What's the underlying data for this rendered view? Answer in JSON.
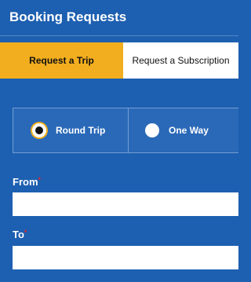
{
  "header": {
    "title": "Booking Requests"
  },
  "tabs": [
    {
      "label": "Request a Trip",
      "active": true
    },
    {
      "label": "Request a Subscription",
      "active": false
    }
  ],
  "trip_type": {
    "options": [
      {
        "label": "Round Trip",
        "selected": true
      },
      {
        "label": "One Way",
        "selected": false
      }
    ]
  },
  "fields": {
    "from": {
      "label": "From",
      "required_mark": "*",
      "value": ""
    },
    "to": {
      "label": "To",
      "required_mark": "*",
      "value": ""
    }
  },
  "colors": {
    "background": "#1d5fb0",
    "active_tab": "#f2ae1e",
    "required": "#e0292e"
  }
}
